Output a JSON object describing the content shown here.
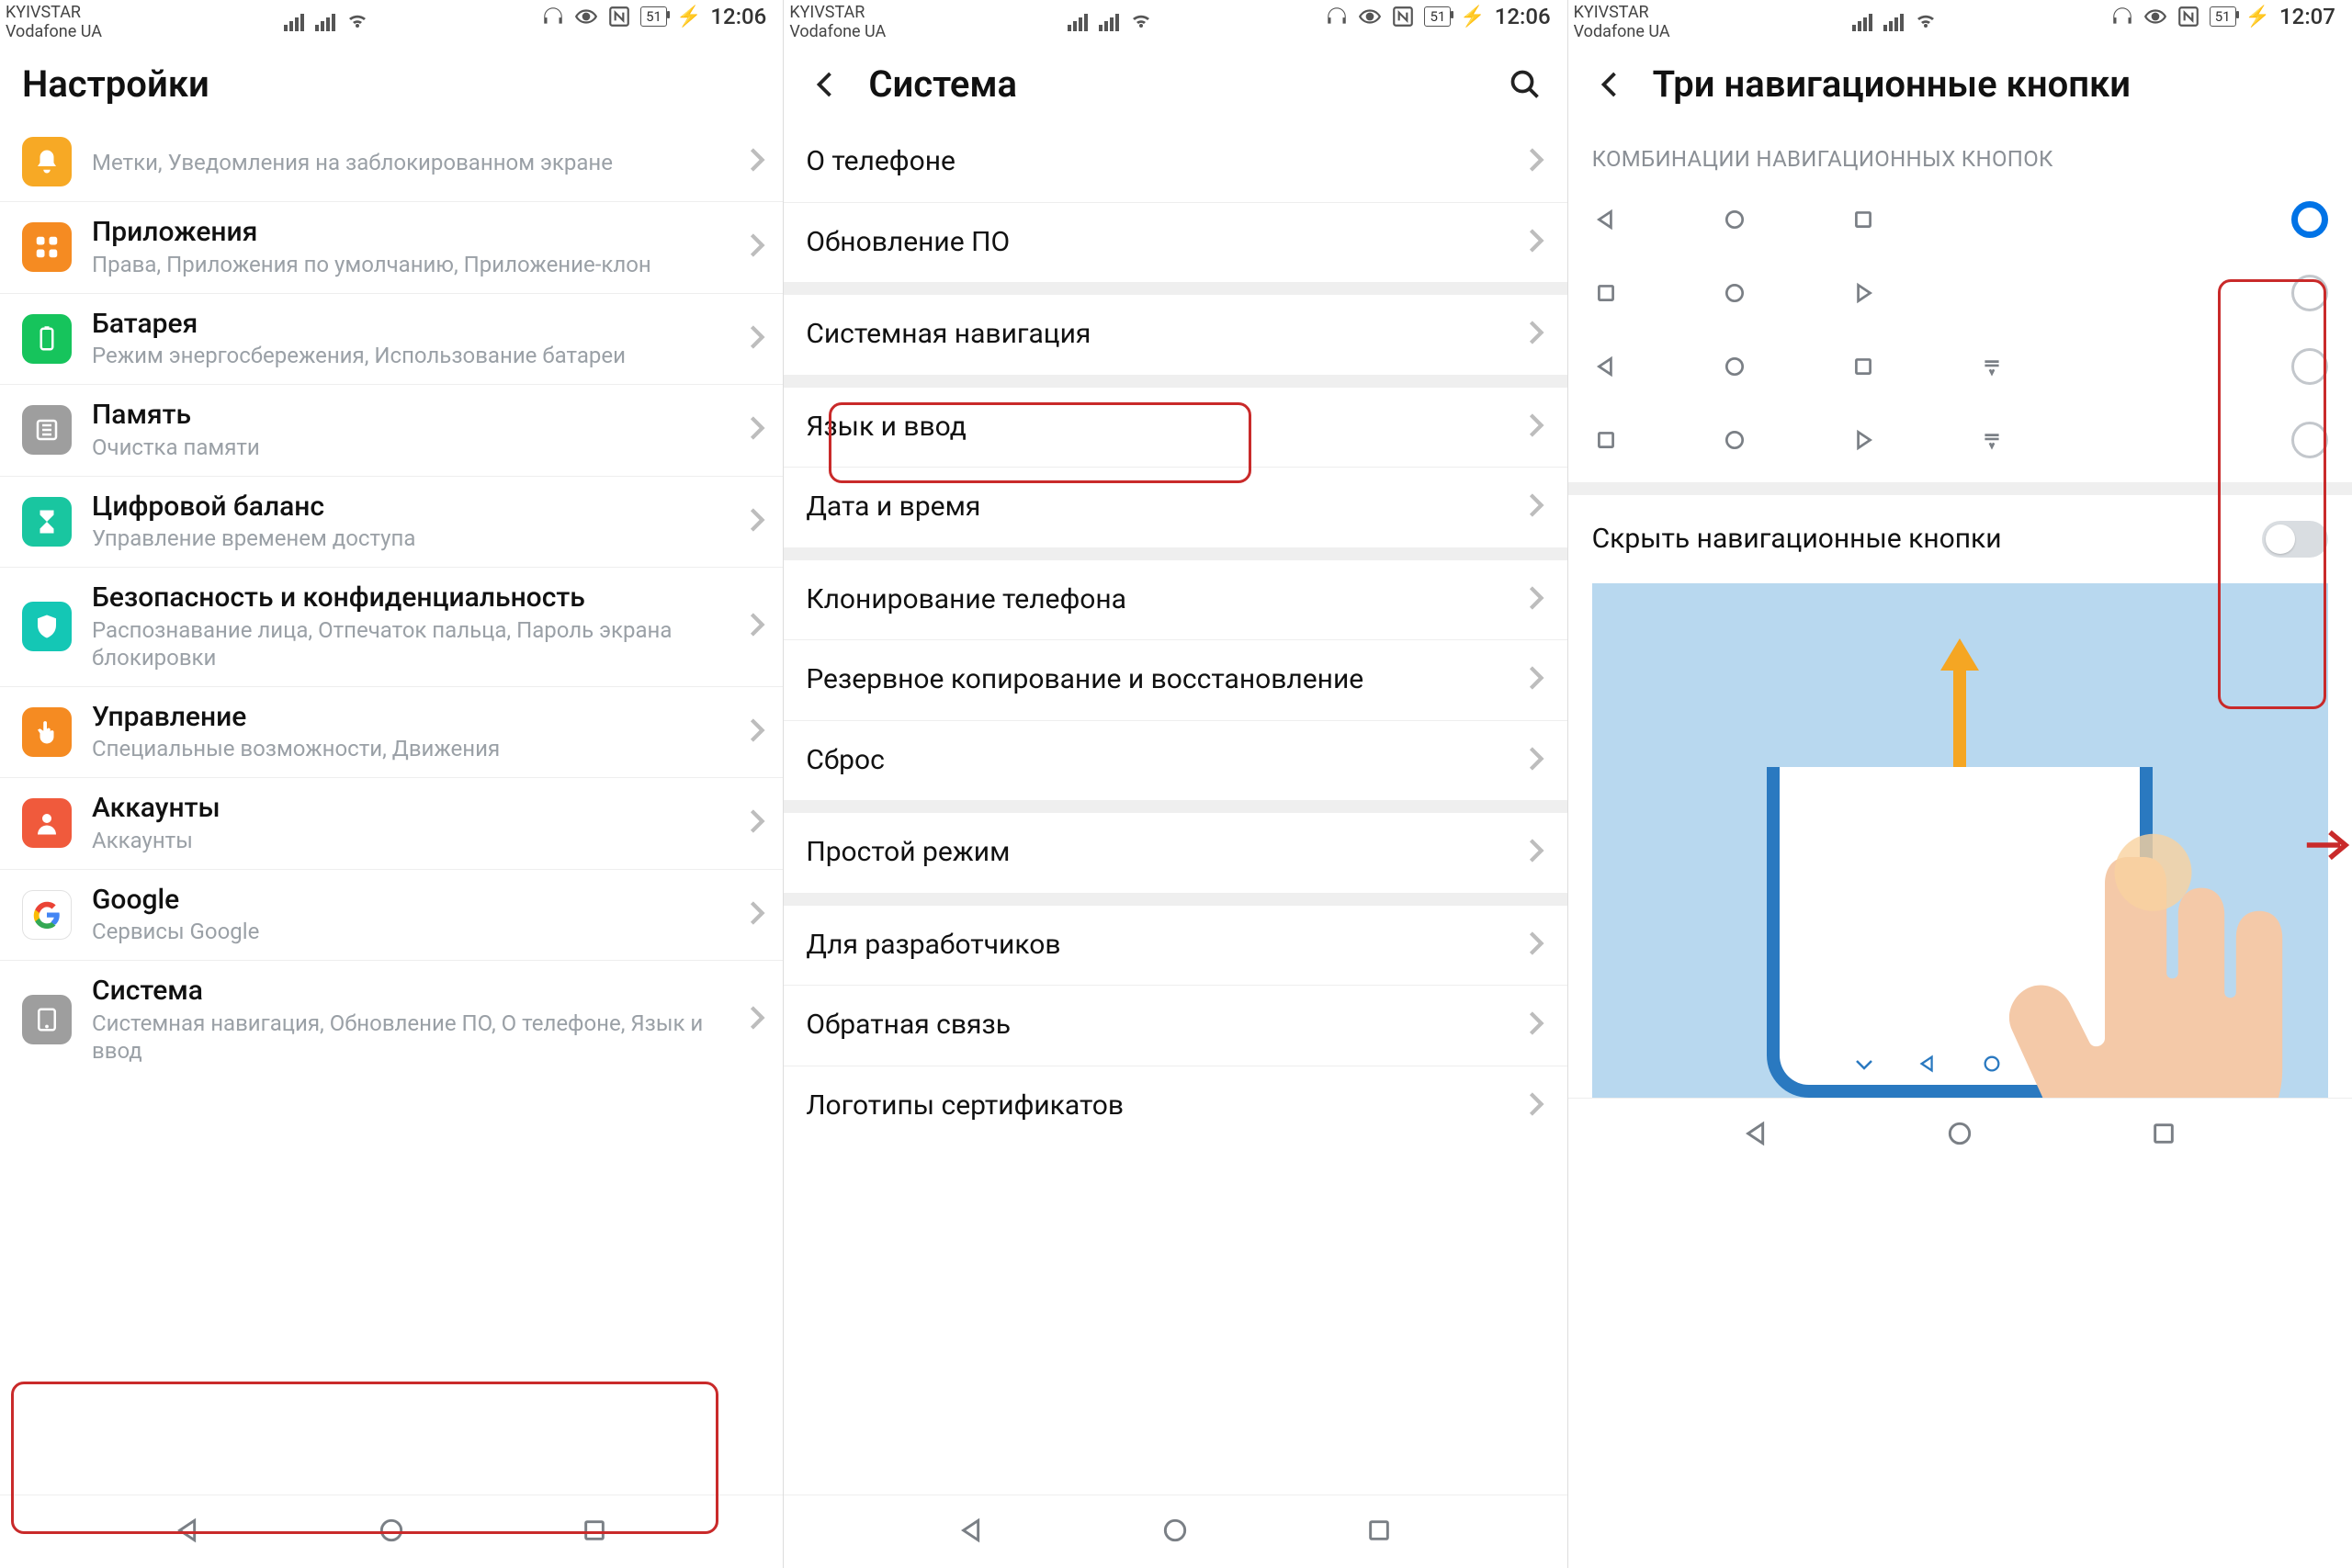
{
  "status": {
    "carrier1": "KYIVSTAR",
    "carrier2": "Vodafone UA",
    "batt": "51",
    "time_a": "12:06",
    "time_b": "12:07"
  },
  "s1": {
    "title": "Настройки",
    "rows": [
      {
        "title": "",
        "sub": "Метки, Уведомления на заблокированном экране"
      },
      {
        "title": "Приложения",
        "sub": "Права, Приложения по умолчанию, Приложение-клон"
      },
      {
        "title": "Батарея",
        "sub": "Режим энергосбережения, Использование батареи"
      },
      {
        "title": "Память",
        "sub": "Очистка памяти"
      },
      {
        "title": "Цифровой баланс",
        "sub": "Управление временем доступа"
      },
      {
        "title": "Безопасность и конфиденциальность",
        "sub": "Распознавание лица, Отпечаток пальца, Пароль экрана блокировки"
      },
      {
        "title": "Управление",
        "sub": "Специальные возможности, Движения"
      },
      {
        "title": "Аккаунты",
        "sub": "Аккаунты"
      },
      {
        "title": "Google",
        "sub": "Сервисы Google"
      },
      {
        "title": "Система",
        "sub": "Системная навигация, Обновление ПО, О телефоне, Язык и ввод"
      }
    ]
  },
  "s2": {
    "title": "Система",
    "groups": [
      [
        "О телефоне",
        "Обновление ПО"
      ],
      [
        "Системная навигация"
      ],
      [
        "Язык и ввод",
        "Дата и время"
      ],
      [
        "Клонирование телефона",
        "Резервное копирование и восстановление",
        "Сброс"
      ],
      [
        "Простой режим"
      ],
      [
        "Для разработчиков",
        "Обратная связь",
        "Логотипы сертификатов"
      ]
    ]
  },
  "s3": {
    "title": "Три навигационные кнопки",
    "section": "КОМБИНАЦИИ НАВИГАЦИОННЫХ КНОПОК",
    "hide_label": "Скрыть навигационные кнопки",
    "combos": [
      {
        "order": [
          "back",
          "home",
          "recent"
        ],
        "extra": false,
        "selected": true
      },
      {
        "order": [
          "recent",
          "home",
          "back"
        ],
        "extra": false,
        "selected": false
      },
      {
        "order": [
          "back",
          "home",
          "recent"
        ],
        "extra": true,
        "selected": false
      },
      {
        "order": [
          "recent",
          "home",
          "back"
        ],
        "extra": true,
        "selected": false
      }
    ]
  }
}
